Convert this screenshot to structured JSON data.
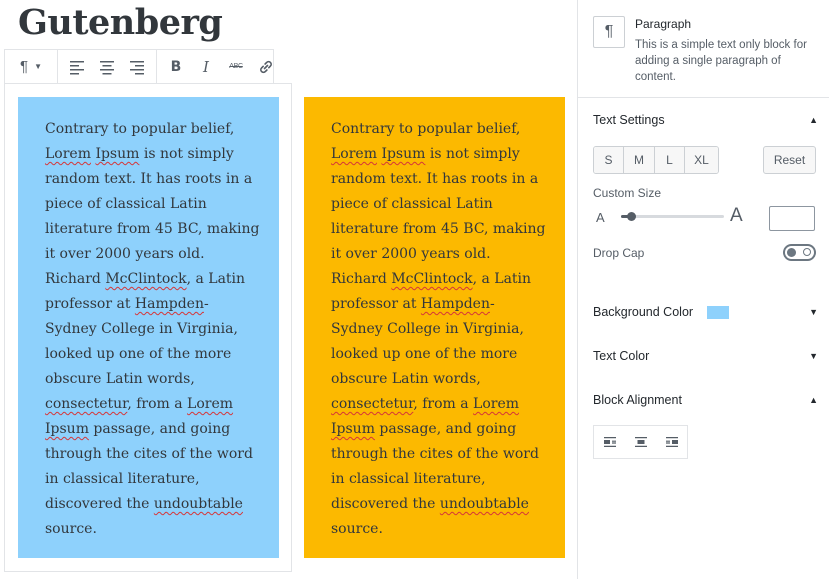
{
  "editor": {
    "title": "Gutenberg",
    "toolbar": {
      "paragraph_glyph": "¶"
    },
    "blocks": [
      {
        "background": "#8ed1fc",
        "lines": [
          {
            "segments": [
              {
                "t": "Contrary to popular belief,"
              }
            ]
          },
          {
            "segments": [
              {
                "t": "Lorem",
                "sq": true
              },
              {
                "t": " "
              },
              {
                "t": "Ipsum",
                "sq": true
              },
              {
                "t": " is not simply"
              }
            ]
          },
          {
            "segments": [
              {
                "t": "random text. It has roots in a"
              }
            ]
          },
          {
            "segments": [
              {
                "t": "piece of classical Latin"
              }
            ]
          },
          {
            "segments": [
              {
                "t": "literature from 45 BC, making"
              }
            ]
          },
          {
            "segments": [
              {
                "t": "it over 2000 years old."
              }
            ]
          },
          {
            "segments": [
              {
                "t": "Richard "
              },
              {
                "t": "McClintock",
                "sq": true
              },
              {
                "t": ", a Latin"
              }
            ]
          },
          {
            "segments": [
              {
                "t": "professor at "
              },
              {
                "t": "Hampden",
                "sq": true
              },
              {
                "t": "-"
              }
            ]
          },
          {
            "segments": [
              {
                "t": "Sydney College in Virginia,"
              }
            ]
          },
          {
            "segments": [
              {
                "t": "looked up one of the more"
              }
            ]
          },
          {
            "segments": [
              {
                "t": "obscure Latin words,"
              }
            ]
          },
          {
            "segments": [
              {
                "t": "consectetur",
                "sq": true
              },
              {
                "t": ", from a "
              },
              {
                "t": "Lorem",
                "sq": true
              }
            ]
          },
          {
            "segments": [
              {
                "t": "Ipsum",
                "sq": true
              },
              {
                "t": " passage, and going"
              }
            ]
          },
          {
            "segments": [
              {
                "t": "through the cites of the word"
              }
            ]
          },
          {
            "segments": [
              {
                "t": "in classical literature,"
              }
            ]
          },
          {
            "segments": [
              {
                "t": "discovered the "
              },
              {
                "t": "undoubtable",
                "sq": true
              }
            ]
          },
          {
            "segments": [
              {
                "t": "source."
              }
            ]
          }
        ]
      },
      {
        "background": "#fcb900",
        "lines": [
          {
            "segments": [
              {
                "t": "Contrary to popular belief,"
              }
            ]
          },
          {
            "segments": [
              {
                "t": "Lorem",
                "sq": true
              },
              {
                "t": " "
              },
              {
                "t": "Ipsum",
                "sq": true
              },
              {
                "t": " is not simply"
              }
            ]
          },
          {
            "segments": [
              {
                "t": "random text. It has roots in a"
              }
            ]
          },
          {
            "segments": [
              {
                "t": "piece of classical Latin"
              }
            ]
          },
          {
            "segments": [
              {
                "t": "literature from 45 BC, making"
              }
            ]
          },
          {
            "segments": [
              {
                "t": "it over 2000 years old."
              }
            ]
          },
          {
            "segments": [
              {
                "t": "Richard "
              },
              {
                "t": "McClintock",
                "sq": true
              },
              {
                "t": ", a Latin"
              }
            ]
          },
          {
            "segments": [
              {
                "t": "professor at "
              },
              {
                "t": "Hampden",
                "sq": true
              },
              {
                "t": "-"
              }
            ]
          },
          {
            "segments": [
              {
                "t": "Sydney College in Virginia,"
              }
            ]
          },
          {
            "segments": [
              {
                "t": "looked up one of the more"
              }
            ]
          },
          {
            "segments": [
              {
                "t": "obscure Latin words,"
              }
            ]
          },
          {
            "segments": [
              {
                "t": "consectetur",
                "sq": true
              },
              {
                "t": ", from a "
              },
              {
                "t": "Lorem",
                "sq": true
              }
            ]
          },
          {
            "segments": [
              {
                "t": "Ipsum",
                "sq": true
              },
              {
                "t": " passage, and going"
              }
            ]
          },
          {
            "segments": [
              {
                "t": "through the cites of the word"
              }
            ]
          },
          {
            "segments": [
              {
                "t": "in classical literature,"
              }
            ]
          },
          {
            "segments": [
              {
                "t": "discovered the "
              },
              {
                "t": "undoubtable",
                "sq": true
              }
            ]
          },
          {
            "segments": [
              {
                "t": "source."
              }
            ]
          }
        ]
      }
    ]
  },
  "sidebar": {
    "block_card": {
      "icon": "paragraph-icon",
      "glyph": "¶",
      "title": "Paragraph",
      "description": "This is a simple text only block for adding a single paragraph of content."
    },
    "text_settings": {
      "title": "Text Settings",
      "expanded": true,
      "sizes": [
        "S",
        "M",
        "L",
        "XL"
      ],
      "reset_label": "Reset",
      "custom_size_label": "Custom Size",
      "small_a": "A",
      "big_a": "A",
      "slider_fraction": 0.1,
      "custom_size_value": "",
      "drop_cap_label": "Drop Cap",
      "drop_cap_on": false
    },
    "background_color": {
      "title": "Background Color",
      "swatch": "#8ed1fc",
      "expanded": false
    },
    "text_color": {
      "title": "Text Color",
      "expanded": false
    },
    "block_alignment": {
      "title": "Block Alignment",
      "expanded": true,
      "options": [
        "align-left-icon",
        "align-center-icon",
        "align-right-icon"
      ]
    }
  }
}
